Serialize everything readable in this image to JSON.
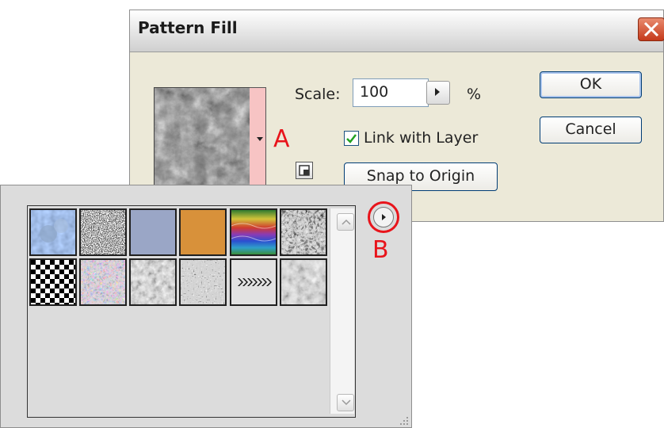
{
  "dialog": {
    "title": "Pattern Fill",
    "scale_label": "Scale:",
    "scale_value": "100",
    "percent": "%",
    "link_label": "Link with Layer",
    "link_checked": true,
    "snap_button": "Snap to Origin",
    "ok_button": "OK",
    "cancel_button": "Cancel"
  },
  "annotations": {
    "a": "A",
    "b": "B"
  },
  "picker": {
    "patterns": [
      "blue-bubbles-pattern",
      "noise-pattern",
      "blue-solid-pattern",
      "orange-solid-pattern",
      "rainbow-wave-pattern",
      "grunge-pattern",
      "checker-pattern",
      "colorful-confetti-pattern",
      "soft-clouds-pattern",
      "gray-noise-pattern",
      "arrows-pattern",
      "clouds-pattern"
    ]
  },
  "colors": {
    "accent_red": "#e8141b",
    "dialog_bg": "#ece9d8",
    "picker_bg": "#dcdcdc"
  }
}
